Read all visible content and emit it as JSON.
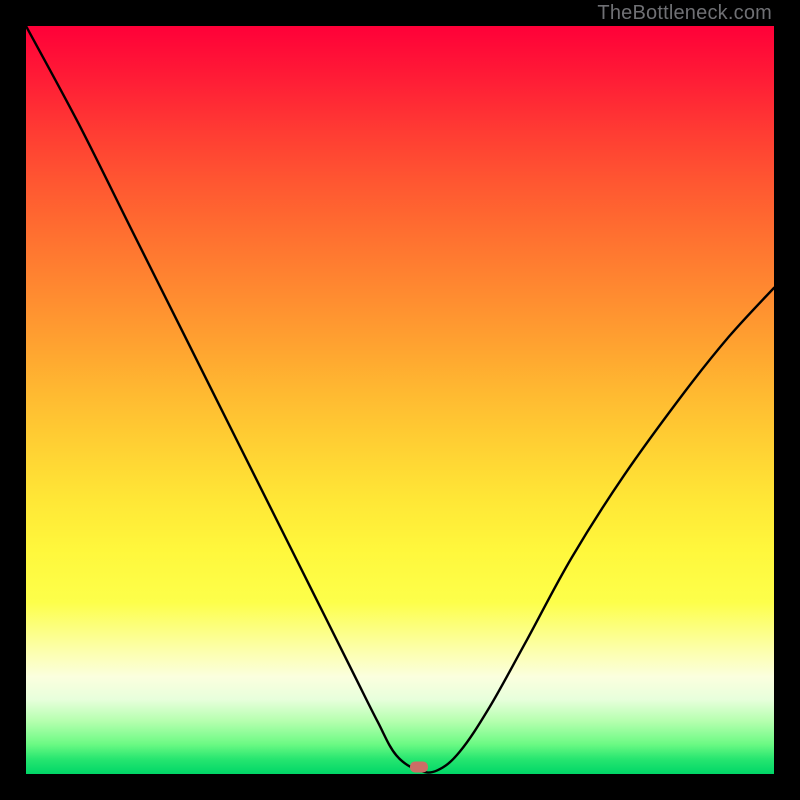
{
  "watermark": "TheBottleneck.com",
  "marker": {
    "x_pct": 52.5,
    "y_pct": 99.0
  },
  "chart_data": {
    "type": "line",
    "title": "",
    "xlabel": "",
    "ylabel": "",
    "xlim": [
      0,
      100
    ],
    "ylim": [
      0,
      100
    ],
    "series": [
      {
        "name": "curve",
        "x": [
          0,
          7.0,
          14.0,
          21.0,
          28.0,
          35.0,
          40.0,
          44.0,
          47.0,
          49.5,
          52.5,
          55.0,
          58.0,
          62.0,
          67.0,
          73.0,
          80.0,
          88.0,
          94.0,
          100.0
        ],
        "values": [
          100,
          87.0,
          73.0,
          59.0,
          45.0,
          31.0,
          21.0,
          13.0,
          7.0,
          2.5,
          0.5,
          0.5,
          3.0,
          9.0,
          18.0,
          29.0,
          40.0,
          51.0,
          58.5,
          65.0
        ]
      }
    ],
    "marker_point": {
      "x": 52.5,
      "y": 0.5
    },
    "background_gradient": "vertical red→orange→yellow→pale→green"
  }
}
